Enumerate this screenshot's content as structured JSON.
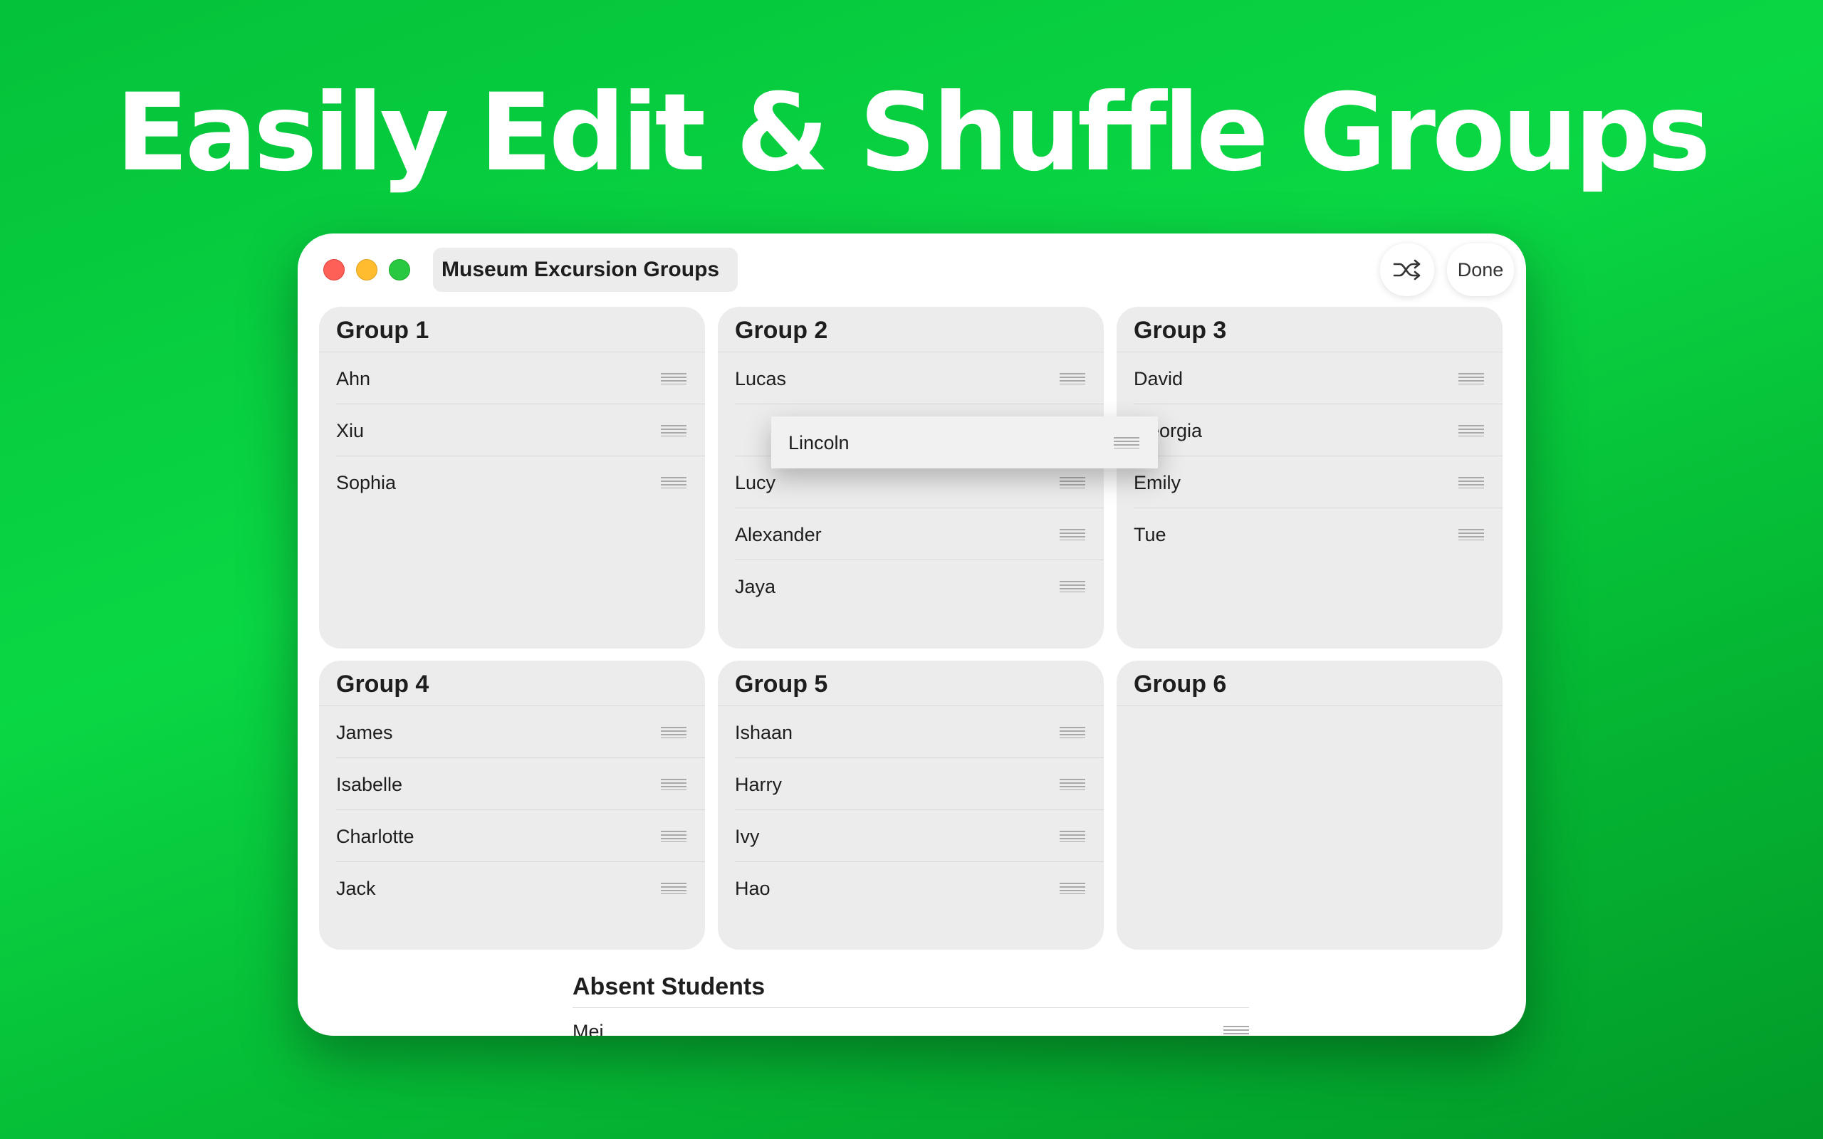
{
  "headline": "Easily Edit & Shuffle Groups",
  "window": {
    "title": "Museum Excursion Groups",
    "done_label": "Done",
    "shuffle_icon": "shuffle-icon"
  },
  "groups": [
    {
      "title": "Group 1",
      "members": [
        "Ahn",
        "Xiu",
        "Sophia"
      ]
    },
    {
      "title": "Group 2",
      "members": [
        "Lucas",
        "",
        "Lucy",
        "Alexander",
        "Jaya"
      ]
    },
    {
      "title": "Group 3",
      "members": [
        "David",
        "Georgia",
        "Emily",
        "Tue"
      ]
    },
    {
      "title": "Group 4",
      "members": [
        "James",
        "Isabelle",
        "Charlotte",
        "Jack"
      ]
    },
    {
      "title": "Group 5",
      "members": [
        "Ishaan",
        "Harry",
        "Ivy",
        "Hao"
      ]
    },
    {
      "title": "Group 6",
      "members": []
    }
  ],
  "dragging": {
    "name": "Lincoln"
  },
  "absent": {
    "title": "Absent Students",
    "members": [
      "Mei"
    ]
  },
  "colors": {
    "accent_green": "#0ad744",
    "card_bg": "#ececec",
    "close": "#fe5f57",
    "minimize": "#febc2e",
    "zoom": "#28c840"
  }
}
